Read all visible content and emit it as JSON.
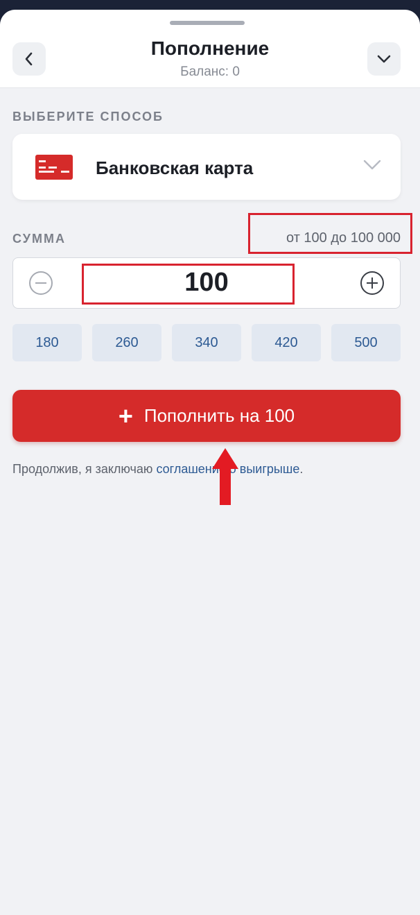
{
  "header": {
    "title": "Пополнение",
    "balance": "Баланс: 0",
    "back_icon": "chevron-left-icon",
    "collapse_icon": "chevron-down-icon"
  },
  "method": {
    "section_label": "ВЫБЕРИТЕ СПОСОБ",
    "selected": "Банковская карта",
    "icon": "bank-card-icon"
  },
  "amount": {
    "section_label": "СУММА",
    "range": "от 100 до 100 000",
    "value": "100",
    "minus_icon": "minus-circle-icon",
    "plus_icon": "plus-circle-icon"
  },
  "presets": [
    "180",
    "260",
    "340",
    "420",
    "500"
  ],
  "submit": {
    "plus": "+",
    "label": "Пополнить на 100"
  },
  "terms": {
    "prefix": "Продолжив, я заключаю ",
    "link": "соглашение о выигрыше",
    "suffix": "."
  },
  "colors": {
    "accent_red": "#d52b2a",
    "preset_bg": "#e2e8f1",
    "link_blue": "#2d5a93",
    "annotation_red": "#d8232f"
  }
}
